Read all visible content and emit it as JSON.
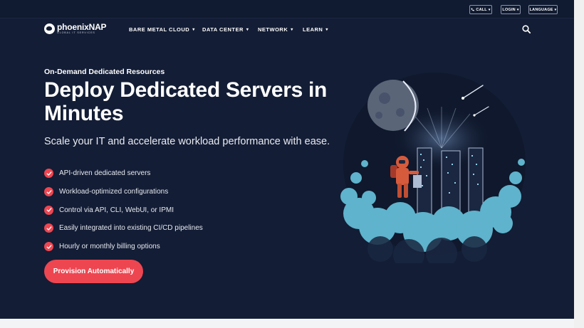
{
  "topbar": {
    "call_label": "CALL",
    "login_label": "LOGIN",
    "language_label": "LANGUAGE"
  },
  "brand": {
    "name": "phoenixNAP",
    "tagline": "GLOBAL IT SERVICES"
  },
  "nav": {
    "items": [
      {
        "label": "BARE METAL CLOUD"
      },
      {
        "label": "DATA CENTER"
      },
      {
        "label": "NETWORK"
      },
      {
        "label": "LEARN"
      }
    ]
  },
  "hero": {
    "eyebrow": "On-Demand Dedicated Resources",
    "headline": "Deploy Dedicated Servers in Minutes",
    "subhead": "Scale your IT and accelerate workload performance with ease.",
    "features": [
      "API-driven dedicated servers",
      "Workload-optimized configurations",
      "Control via API, CLI, WebUI, or IPMI",
      "Easily integrated into existing CI/CD pipelines",
      "Hourly or monthly billing options"
    ],
    "cta_label": "Provision Automatically"
  },
  "colors": {
    "background": "#131d35",
    "accent": "#ee4651",
    "cloud": "#5fb3cc"
  },
  "icons": {
    "search": "search-icon",
    "phone": "phone-icon",
    "check": "check-icon"
  }
}
